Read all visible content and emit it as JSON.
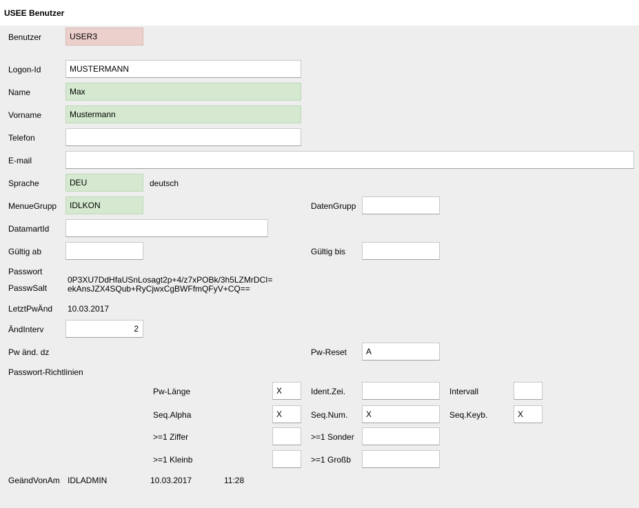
{
  "window": {
    "title": "USEE Benutzer"
  },
  "colors": {
    "required_field": "#d4e9cf",
    "readonly_field": "#ecd0cb",
    "panel": "#eeeeee"
  },
  "form": {
    "benutzer": {
      "label": "Benutzer",
      "value": "USER3"
    },
    "logon_id": {
      "label": "Logon-Id",
      "value": "MUSTERMANN"
    },
    "name": {
      "label": "Name",
      "value": "Max"
    },
    "vorname": {
      "label": "Vorname",
      "value": "Mustermann"
    },
    "telefon": {
      "label": "Telefon",
      "value": ""
    },
    "email": {
      "label": "E-mail",
      "value": ""
    },
    "sprache": {
      "label": "Sprache",
      "value": "DEU",
      "text": "deutsch"
    },
    "menuegrupp": {
      "label": "MenueGrupp",
      "value": "IDLKON"
    },
    "datengrupp": {
      "label": "DatenGrupp",
      "value": ""
    },
    "datamartid": {
      "label": "DatamartId",
      "value": ""
    },
    "gueltig_ab": {
      "label": "Gültig ab",
      "value": ""
    },
    "gueltig_bis": {
      "label": "Gültig bis",
      "value": ""
    },
    "passwort": {
      "label": "Passwort",
      "value": "0P3XU7DdHfaUSnLosagt2p+4/z7xPOBk/3h5LZMrDCI="
    },
    "passwsalt": {
      "label": "PasswSalt",
      "value": "ekAnsJZX4SQub+RyCjwxCgBWFfmQFyV+CQ=="
    },
    "letztpwaend": {
      "label": "LetztPwÄnd",
      "value": "10.03.2017"
    },
    "aendinterv": {
      "label": "ÄndInterv",
      "value": "2"
    },
    "pw_aend_dz": {
      "label": "Pw änd. dz"
    },
    "pw_reset": {
      "label": "Pw-Reset",
      "value": "A"
    }
  },
  "richtlinien": {
    "label": "Passwort-Richtlinien",
    "pw_laenge": {
      "label": "Pw-Länge",
      "value": "X"
    },
    "ident_zei": {
      "label": "Ident.Zei.",
      "value": ""
    },
    "intervall": {
      "label": "Intervall",
      "value": ""
    },
    "seq_alpha": {
      "label": "Seq.Alpha",
      "value": "X"
    },
    "seq_num": {
      "label": "Seq.Num.",
      "value": "X"
    },
    "seq_keyb": {
      "label": "Seq.Keyb.",
      "value": "X"
    },
    "ziffer": {
      "label": ">=1 Ziffer",
      "value": ""
    },
    "sonder": {
      "label": ">=1 Sonder",
      "value": ""
    },
    "kleinb": {
      "label": ">=1 Kleinb",
      "value": ""
    },
    "grossb": {
      "label": ">=1 Großb",
      "value": ""
    }
  },
  "footer": {
    "label": "GeändVonAm",
    "user": "IDLADMIN",
    "date": "10.03.2017",
    "time": "11:28"
  }
}
